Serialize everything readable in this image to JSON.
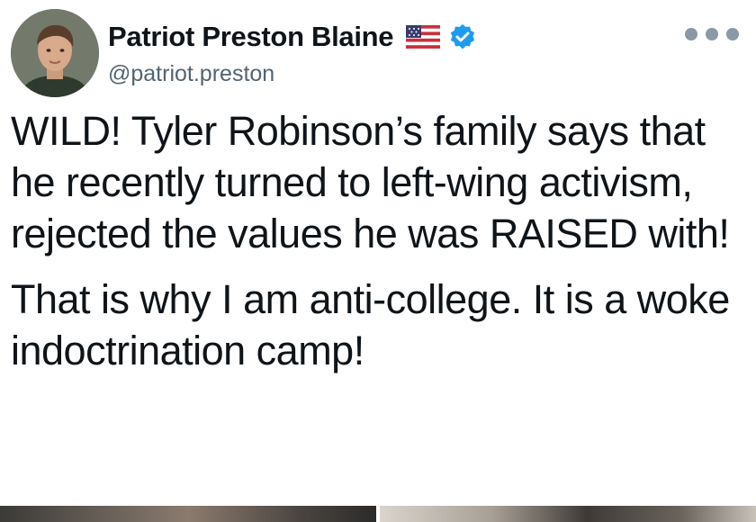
{
  "author": {
    "display_name": "Patriot Preston Blaine",
    "handle": "@patriot.preston",
    "flag_icon": "us-flag-icon",
    "verified_icon": "verified-badge-icon",
    "verified_color": "#1d9bf0"
  },
  "tweet": {
    "paragraphs": [
      "WILD! Tyler Robinson’s family says that he recently turned to left-wing activism, rejected the values he was RAISED with!",
      "That is why I am anti-college. It is a woke indoctrination camp!"
    ]
  },
  "actions": {
    "more_icon": "more-options-icon"
  }
}
